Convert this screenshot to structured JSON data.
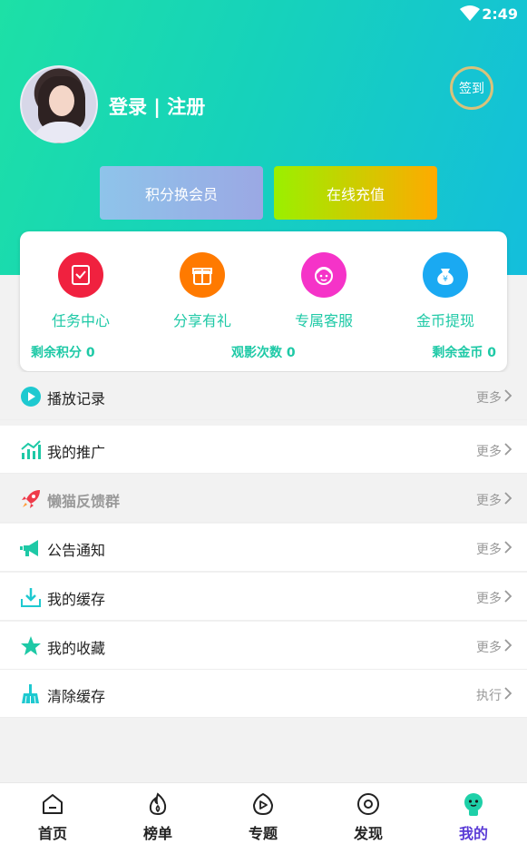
{
  "status": {
    "time": "2:49"
  },
  "profile": {
    "login_text": "登录 | 注册",
    "signin_label": "签到"
  },
  "actions": {
    "points_label": "积分换会员",
    "recharge_label": "在线充值"
  },
  "features": [
    {
      "label": "任务中心",
      "icon": "task-icon",
      "color": "#f0213f"
    },
    {
      "label": "分享有礼",
      "icon": "gift-icon",
      "color": "#ff7a00"
    },
    {
      "label": "专属客服",
      "icon": "service-icon",
      "color": "#f533c8"
    },
    {
      "label": "金币提现",
      "icon": "money-bag-icon",
      "color": "#1aa9f2"
    }
  ],
  "stats": {
    "points": "剩余积分 0",
    "views": "观影次数 0",
    "coins": "剩余金币 0"
  },
  "menu": [
    {
      "label": "播放记录",
      "action": "更多",
      "icon": "play-icon"
    },
    {
      "label": "我的推广",
      "action": "更多",
      "icon": "chart-icon"
    },
    {
      "label": "懒猫反馈群",
      "action": "更多",
      "icon": "rocket-icon"
    },
    {
      "label": "公告通知",
      "action": "更多",
      "icon": "megaphone-icon"
    },
    {
      "label": "我的缓存",
      "action": "更多",
      "icon": "download-icon"
    },
    {
      "label": "我的收藏",
      "action": "更多",
      "icon": "star-icon"
    },
    {
      "label": "清除缓存",
      "action": "执行",
      "icon": "broom-icon"
    }
  ],
  "tabs": [
    {
      "label": "首页",
      "icon": "home-icon"
    },
    {
      "label": "榜单",
      "icon": "flame-icon"
    },
    {
      "label": "专题",
      "icon": "topic-play-icon"
    },
    {
      "label": "发现",
      "icon": "discover-icon"
    },
    {
      "label": "我的",
      "icon": "profile-icon"
    }
  ],
  "colors": {
    "accent": "#1ec9a6",
    "tab_active": "#5a3bd6"
  }
}
